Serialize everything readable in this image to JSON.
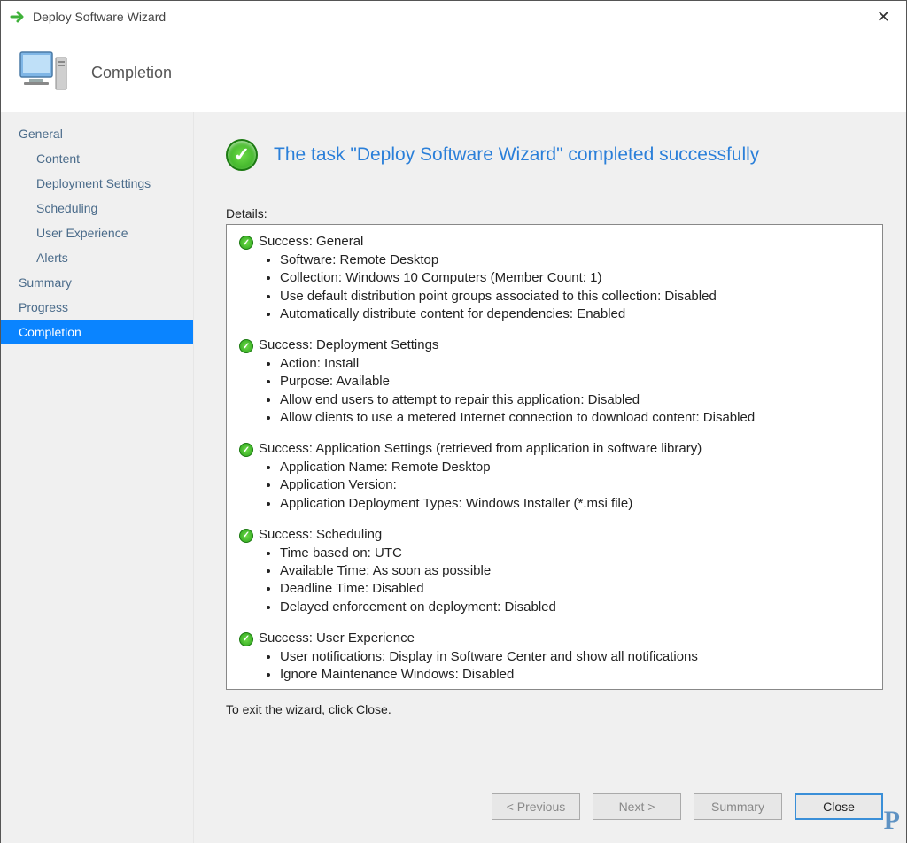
{
  "window": {
    "title": "Deploy Software Wizard",
    "close_icon": "✕"
  },
  "header": {
    "page_title": "Completion"
  },
  "sidebar": [
    {
      "label": "General",
      "sub": false,
      "selected": false
    },
    {
      "label": "Content",
      "sub": true,
      "selected": false
    },
    {
      "label": "Deployment Settings",
      "sub": true,
      "selected": false
    },
    {
      "label": "Scheduling",
      "sub": true,
      "selected": false
    },
    {
      "label": "User Experience",
      "sub": true,
      "selected": false
    },
    {
      "label": "Alerts",
      "sub": true,
      "selected": false
    },
    {
      "label": "Summary",
      "sub": false,
      "selected": false
    },
    {
      "label": "Progress",
      "sub": false,
      "selected": false
    },
    {
      "label": "Completion",
      "sub": false,
      "selected": true
    }
  ],
  "main": {
    "success_heading": "The task \"Deploy Software Wizard\" completed successfully",
    "details_label": "Details:",
    "groups": [
      {
        "title": "Success: General",
        "items": [
          "Software: Remote Desktop",
          "Collection: Windows 10 Computers (Member Count: 1)",
          "Use default distribution point groups associated to this collection: Disabled",
          "Automatically distribute content for dependencies: Enabled"
        ]
      },
      {
        "title": "Success: Deployment Settings",
        "items": [
          "Action: Install",
          "Purpose: Available",
          "Allow end users to attempt to repair this application: Disabled",
          "Allow clients to use a metered Internet connection to download content: Disabled"
        ]
      },
      {
        "title": "Success: Application Settings (retrieved from application in software library)",
        "items": [
          "Application Name: Remote Desktop",
          "Application Version:",
          "Application Deployment Types: Windows Installer (*.msi file)"
        ]
      },
      {
        "title": "Success: Scheduling",
        "items": [
          "Time based on: UTC",
          "Available Time: As soon as possible",
          "Deadline Time: Disabled",
          "Delayed enforcement on deployment: Disabled"
        ]
      },
      {
        "title": "Success: User Experience",
        "items": [
          "User notifications: Display in Software Center and show all notifications",
          "Ignore Maintenance Windows: Disabled"
        ]
      }
    ],
    "exit_hint": "To exit the wizard, click Close."
  },
  "buttons": {
    "previous": "< Previous",
    "next": "Next >",
    "summary": "Summary",
    "close": "Close"
  }
}
